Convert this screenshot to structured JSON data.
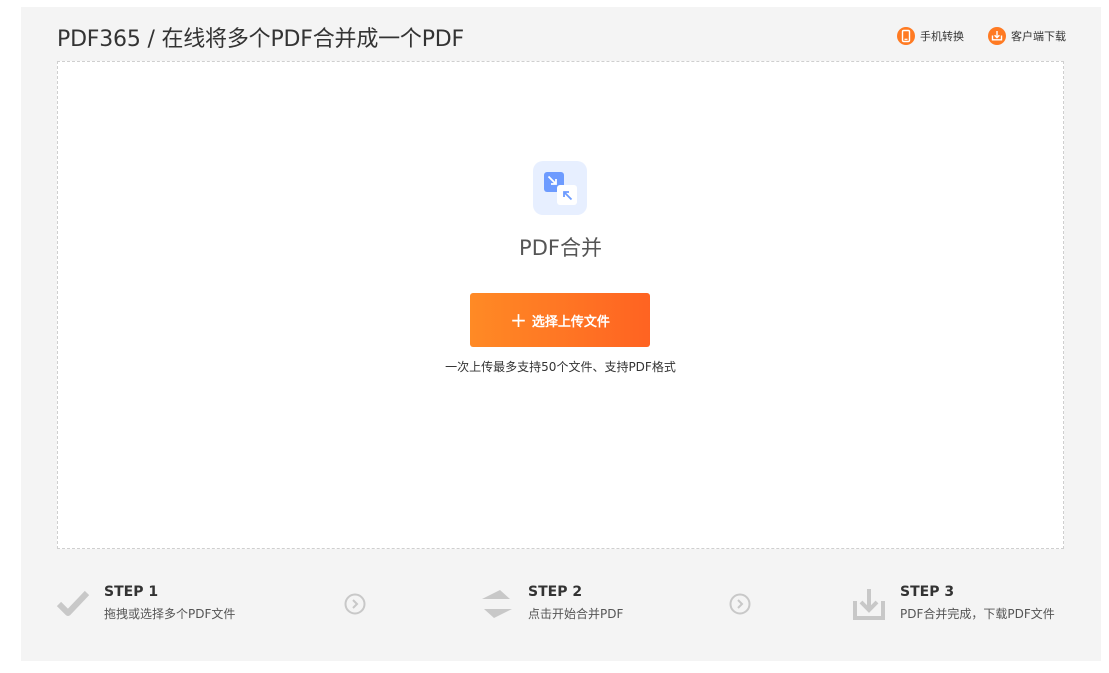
{
  "header": {
    "title": "PDF365 / 在线将多个PDF合并成一个PDF",
    "links": [
      {
        "label": "手机转换",
        "icon": "mobile-icon"
      },
      {
        "label": "客户端下载",
        "icon": "download-icon"
      }
    ]
  },
  "dropzone": {
    "icon": "merge-icon",
    "title": "PDF合并",
    "upload_label": "选择上传文件",
    "hint": "一次上传最多支持50个文件、支持PDF格式"
  },
  "steps": [
    {
      "title": "STEP 1",
      "desc": "拖拽或选择多个PDF文件",
      "icon": "checkmark-icon"
    },
    {
      "title": "STEP 2",
      "desc": "点击开始合并PDF",
      "icon": "swap-icon"
    },
    {
      "title": "STEP 3",
      "desc": "PDF合并完成，下载PDF文件",
      "icon": "tray-download-icon"
    }
  ],
  "colors": {
    "accent": "#ff7a22",
    "panel_bg": "#f4f4f4",
    "icon_gray": "#c8c8c8",
    "icon_blue": "#6d9bff"
  }
}
